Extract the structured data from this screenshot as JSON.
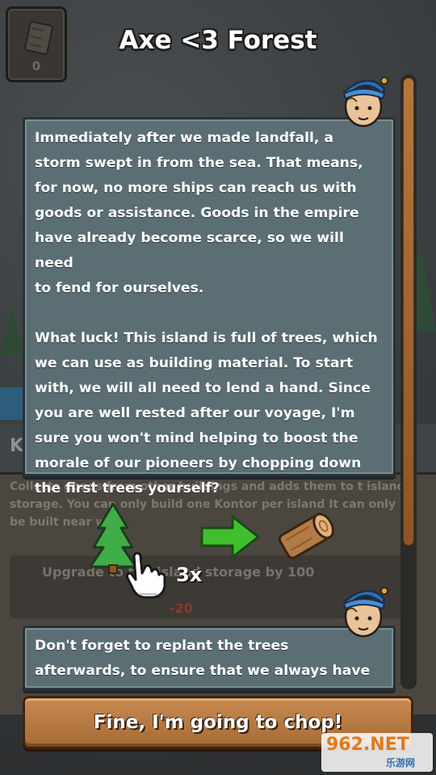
{
  "title": "Axe <3 Forest",
  "resource": {
    "icon": "wood-plank-icon",
    "count": "0"
  },
  "background": {
    "panel_header_letter": "K",
    "panel_text": "Collects goods from other buildings and adds them to t island storage. You can only build one Kontor per island It can only be built near wa",
    "upgrade_text": "Upgrade to the island storage by 100",
    "cost": "-20"
  },
  "dialog_1": {
    "text": "Immediately after we made landfall, a\nstorm swept in from the sea. That means,\nfor now, no more ships can reach us with\ngoods or assistance. Goods in the empire\nhave already become scarce, so we will need\nto fend for ourselves.\n\nWhat luck! This island is full of trees, which\nwe can use as building material. To start\nwith, we will all need to lend a hand. Since\nyou are well rested after our voyage, I'm\nsure you won't mind helping to boost the\nmorale of our pioneers by chopping down\nthe first trees yourself?"
  },
  "dialog_2": {
    "text": "Don't forget to replant the trees\nafterwards, to ensure that we always have"
  },
  "tutorial": {
    "tap_count": "3x"
  },
  "action_button": {
    "label": "Fine, I'm going to chop!"
  },
  "watermark": {
    "main": "962.NET",
    "sub": "乐游网"
  },
  "colors": {
    "dialog_bg": "#5a6e74",
    "button_bg": "#b9793f",
    "scroll_thumb": "#a8662f",
    "arrow_green": "#3fbf2e"
  }
}
